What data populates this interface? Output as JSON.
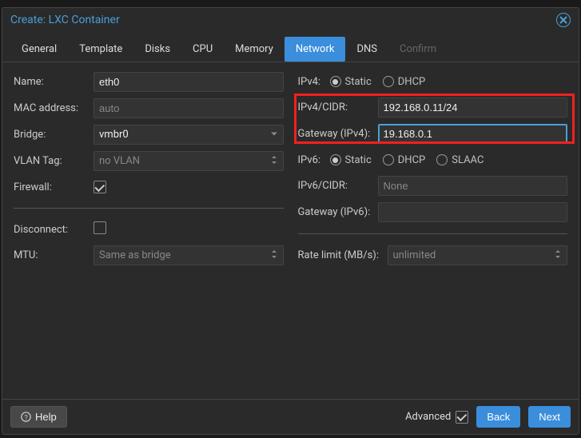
{
  "window": {
    "title": "Create: LXC Container"
  },
  "tabs": [
    "General",
    "Template",
    "Disks",
    "CPU",
    "Memory",
    "Network",
    "DNS",
    "Confirm"
  ],
  "active_tab": 5,
  "disabled_tab": 7,
  "left": {
    "name_label": "Name:",
    "name_value": "eth0",
    "mac_label": "MAC address:",
    "mac_placeholder": "auto",
    "bridge_label": "Bridge:",
    "bridge_value": "vmbr0",
    "vlan_label": "VLAN Tag:",
    "vlan_placeholder": "no VLAN",
    "firewall_label": "Firewall:",
    "firewall_checked": true,
    "disconnect_label": "Disconnect:",
    "disconnect_checked": false,
    "mtu_label": "MTU:",
    "mtu_placeholder": "Same as bridge"
  },
  "right": {
    "ipv4_label": "IPv4:",
    "ipv4_modes": [
      "Static",
      "DHCP"
    ],
    "ipv4_selected": 0,
    "cidr4_label": "IPv4/CIDR:",
    "cidr4_value": "192.168.0.11/24",
    "gw4_label": "Gateway (IPv4):",
    "gw4_value": "19.168.0.1",
    "ipv6_label": "IPv6:",
    "ipv6_modes": [
      "Static",
      "DHCP",
      "SLAAC"
    ],
    "ipv6_selected": 0,
    "cidr6_label": "IPv6/CIDR:",
    "cidr6_placeholder": "None",
    "gw6_label": "Gateway (IPv6):",
    "rate_label": "Rate limit (MB/s):",
    "rate_placeholder": "unlimited"
  },
  "footer": {
    "help": "Help",
    "advanced": "Advanced",
    "advanced_checked": true,
    "back": "Back",
    "next": "Next"
  }
}
